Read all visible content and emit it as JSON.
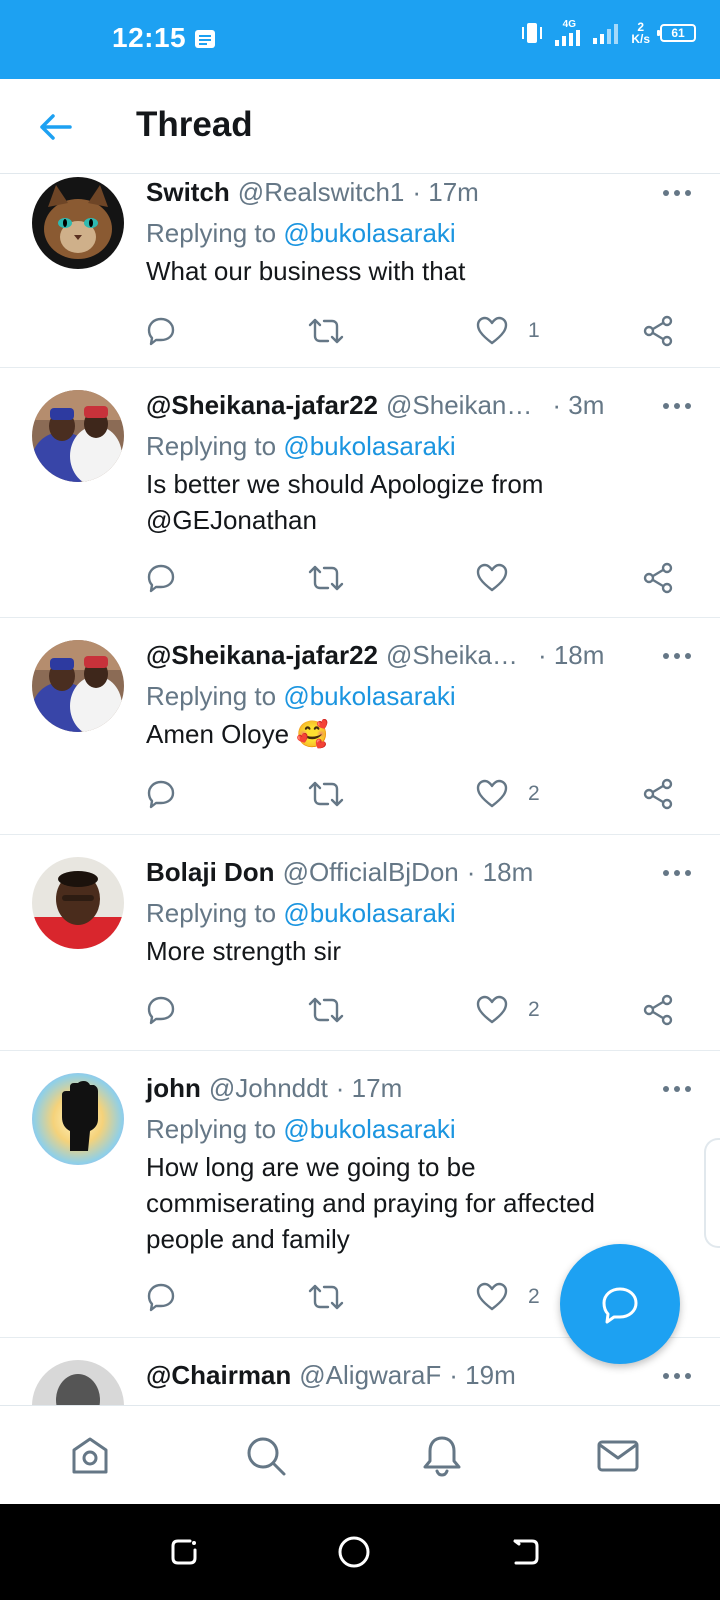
{
  "status_bar": {
    "time": "12:15",
    "network_label": "4G",
    "speed_value": "2",
    "speed_unit": "K/s",
    "battery": "61"
  },
  "header": {
    "title": "Thread"
  },
  "tweets": [
    {
      "name": "Switch",
      "handle": "@Realswitch1",
      "time": "· 17m",
      "reply_prefix": "Replying to ",
      "reply_to": "@bukolasaraki",
      "text_lines": [
        "What our business with that"
      ],
      "like_count": "1"
    },
    {
      "name": "@Sheikana-jafar22",
      "handle": "@Sheikan…",
      "time": "· 3m",
      "reply_prefix": "Replying to ",
      "reply_to": "@bukolasaraki",
      "text_lines": [
        "Is better we should Apologize from"
      ],
      "text_mention": "@GEJonathan",
      "like_count": ""
    },
    {
      "name": "@Sheikana-jafar22",
      "handle": "@Sheika…",
      "time": "· 18m",
      "reply_prefix": "Replying to ",
      "reply_to": "@bukolasaraki",
      "text_lines": [
        "Amen Oloye 🥰"
      ],
      "like_count": "2"
    },
    {
      "name": "Bolaji Don",
      "handle": "@OfficialBjDon",
      "time": "· 18m",
      "reply_prefix": "Replying to ",
      "reply_to": "@bukolasaraki",
      "text_lines": [
        "More strength sir"
      ],
      "like_count": "2"
    },
    {
      "name": "john",
      "handle": "@Johnddt",
      "time": "· 17m",
      "reply_prefix": "Replying to ",
      "reply_to": "@bukolasaraki",
      "text_lines": [
        "How long are we going to be",
        "commiserating and praying for affected",
        "people and family"
      ],
      "like_count": "2"
    },
    {
      "name": "@Chairman",
      "handle": "@AligwaraF",
      "time": "· 19m"
    }
  ],
  "icons": {
    "back": "arrow-left-icon",
    "more": "more-horizontal-icon",
    "reply": "comment-icon",
    "retweet": "retweet-icon",
    "like": "heart-icon",
    "share": "share-icon",
    "compose": "compose-reply-icon",
    "nav": [
      "home-icon",
      "search-icon",
      "bell-icon",
      "mail-icon"
    ]
  },
  "colors": {
    "brand": "#1da1f2",
    "mention": "#1b95e0",
    "secondary_text": "#657786"
  }
}
